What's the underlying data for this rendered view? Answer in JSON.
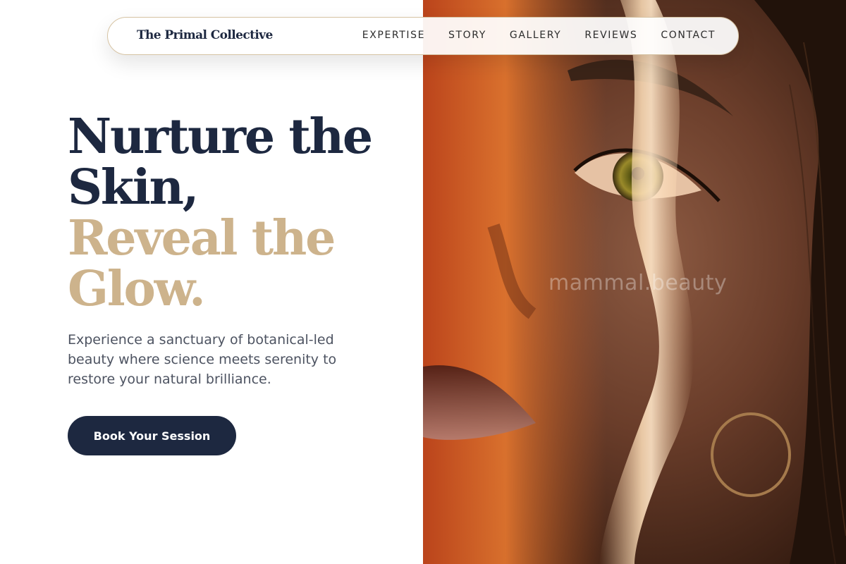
{
  "brand": {
    "name": "The Primal Collective"
  },
  "nav": {
    "links": [
      {
        "label": "EXPERTISE"
      },
      {
        "label": "STORY"
      },
      {
        "label": "GALLERY"
      },
      {
        "label": "REVIEWS"
      },
      {
        "label": "CONTACT"
      }
    ]
  },
  "hero": {
    "headline_line1": "Nurture the",
    "headline_line2": "Skin,",
    "headline_line3": "Reveal the",
    "headline_line4": "Glow.",
    "description": "Experience a sanctuary of botanical-led beauty where science meets serenity to restore your natural brilliance.",
    "cta_label": "Book Your Session"
  },
  "image": {
    "watermark": "mammal.beauty",
    "subject": "close-up portrait of a woman with warm light across her face and a gold hoop earring"
  },
  "colors": {
    "navy": "#1d2840",
    "gold": "#cdb38c",
    "body_text": "#4d5361",
    "nav_border": "#d6c3a3"
  }
}
